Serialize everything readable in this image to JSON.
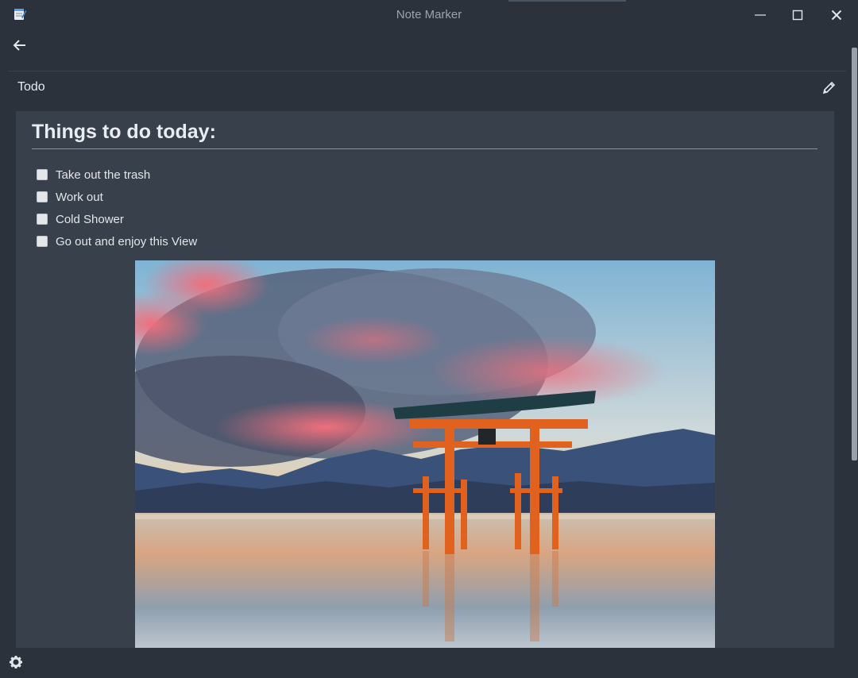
{
  "window": {
    "title": "Note Marker",
    "app_icon": "notepad-icon",
    "controls": {
      "minimize": "minimize-icon",
      "maximize": "maximize-icon",
      "close": "close-icon"
    }
  },
  "nav": {
    "back_icon": "arrow-left-icon"
  },
  "note": {
    "title": "Todo",
    "edit_icon": "pencil-icon",
    "heading": "Things to do today:",
    "todos": [
      {
        "label": "Take out the trash",
        "checked": false
      },
      {
        "label": "Work out",
        "checked": false
      },
      {
        "label": "Cold Shower",
        "checked": false
      },
      {
        "label": "Go out and enjoy this View",
        "checked": false
      }
    ],
    "image_subject": "torii-gate-sunset-photo"
  },
  "footer": {
    "settings_icon": "gear-icon"
  },
  "colors": {
    "background": "#2b323c",
    "content": "#38404b",
    "text": "#e3e6ea"
  }
}
